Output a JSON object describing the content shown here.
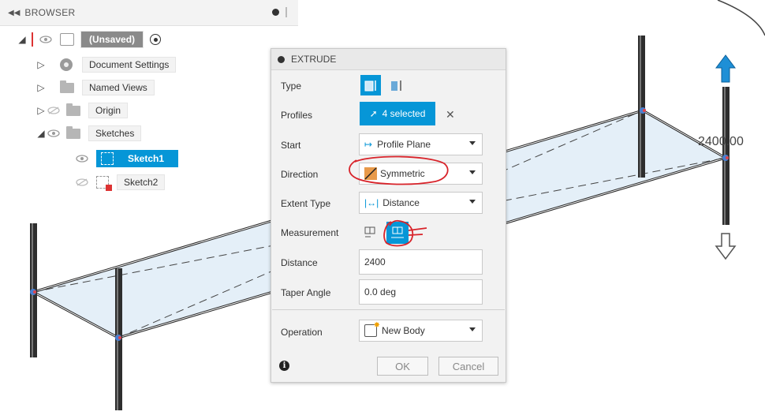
{
  "browser": {
    "title": "BROWSER",
    "root_label": "(Unsaved)",
    "items": [
      {
        "label": "Document Settings"
      },
      {
        "label": "Named Views"
      },
      {
        "label": "Origin"
      },
      {
        "label": "Sketches"
      },
      {
        "label": "Sketch1"
      },
      {
        "label": "Sketch2"
      }
    ]
  },
  "extrude": {
    "title": "EXTRUDE",
    "type_label": "Type",
    "profiles_label": "Profiles",
    "profiles_value": "4 selected",
    "start_label": "Start",
    "start_value": "Profile Plane",
    "direction_label": "Direction",
    "direction_value": "Symmetric",
    "extent_label": "Extent Type",
    "extent_value": "Distance",
    "measurement_label": "Measurement",
    "distance_label": "Distance",
    "distance_value": "2400",
    "taper_label": "Taper Angle",
    "taper_value": "0.0 deg",
    "operation_label": "Operation",
    "operation_value": "New Body",
    "ok_label": "OK",
    "cancel_label": "Cancel"
  },
  "viewport": {
    "dimension_label": "2400.00"
  },
  "colors": {
    "accent": "#0696d7",
    "annotation": "#d8232a",
    "arrow_blue": "#1e8fd6"
  }
}
